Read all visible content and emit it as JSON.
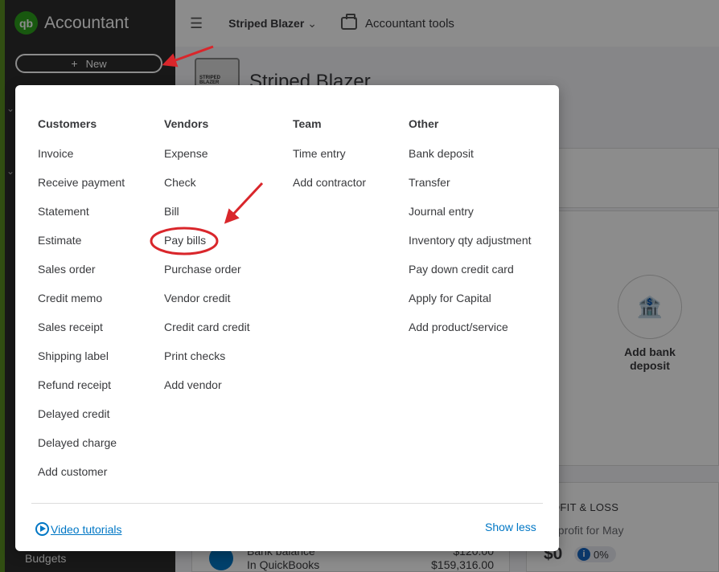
{
  "sidebar": {
    "brand_logo": "qb",
    "brand_name": "Accountant",
    "new_button": "New",
    "budgets": "Budgets"
  },
  "topbar": {
    "company": "Striped Blazer",
    "accountant_tools": "Accountant tools"
  },
  "background": {
    "company_title": "Striped Blazer",
    "company_logo_text": "STRIPED BLAZER",
    "add_bank_deposit": "Add bank deposit",
    "profit_loss_title": "OFIT & LOSS",
    "profit_loss_sub": "t profit for May",
    "profit_value": "$0",
    "profit_pct": "0%",
    "bank_balance_line1": "Bank balance",
    "bank_balance_line2": "In QuickBooks",
    "bank_amt_1": "$120.00",
    "bank_amt_2": "$159,316.00"
  },
  "menu": {
    "columns": [
      {
        "heading": "Customers",
        "items": [
          "Invoice",
          "Receive payment",
          "Statement",
          "Estimate",
          "Sales order",
          "Credit memo",
          "Sales receipt",
          "Shipping label",
          "Refund receipt",
          "Delayed credit",
          "Delayed charge",
          "Add customer"
        ]
      },
      {
        "heading": "Vendors",
        "items": [
          "Expense",
          "Check",
          "Bill",
          "Pay bills",
          "Purchase order",
          "Vendor credit",
          "Credit card credit",
          "Print checks",
          "Add vendor"
        ]
      },
      {
        "heading": "Team",
        "items": [
          "Time entry",
          "Add contractor"
        ]
      },
      {
        "heading": "Other",
        "items": [
          "Bank deposit",
          "Transfer",
          "Journal entry",
          "Inventory qty adjustment",
          "Pay down credit card",
          "Apply for Capital",
          "Add product/service"
        ]
      }
    ],
    "video_tutorials": "Video tutorials",
    "show_less": "Show less"
  },
  "colors": {
    "sidebar_bg": "#2d2d2d",
    "brand_green": "#2ca01c",
    "link_blue": "#0077c5",
    "annotation_red": "#d9262b"
  }
}
